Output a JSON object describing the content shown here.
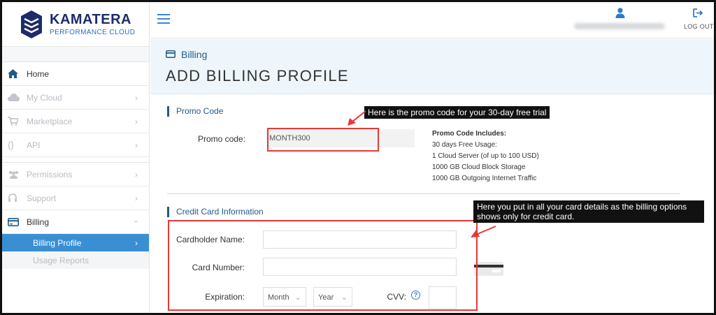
{
  "brand": {
    "name": "KAMATERA",
    "tagline": "PERFORMANCE CLOUD",
    "colors": {
      "navy": "#1d2b6a",
      "blue": "#2e6bbf",
      "accent": "#3a8fd2",
      "annotation_red": "#e53935"
    }
  },
  "sidebar": {
    "items": [
      {
        "label": "Home",
        "icon": "home-icon"
      },
      {
        "label": "My Cloud",
        "icon": "cloud-icon"
      },
      {
        "label": "Marketplace",
        "icon": "cart-icon"
      },
      {
        "label": "API",
        "icon": "code-braces-icon"
      },
      {
        "label": "Permissions",
        "icon": "users-icon"
      },
      {
        "label": "Support",
        "icon": "headset-icon"
      },
      {
        "label": "Billing",
        "icon": "card-icon"
      }
    ],
    "billing_sub": [
      {
        "label": "Billing Profile"
      },
      {
        "label": "Usage Reports"
      }
    ]
  },
  "topbar": {
    "menu_icon": "hamburger-icon",
    "user_icon": "user-icon",
    "logout_icon": "logout-icon",
    "logout_label": "LOG OUT"
  },
  "header": {
    "breadcrumb": "Billing",
    "title": "ADD BILLING PROFILE"
  },
  "promo": {
    "section_title": "Promo Code",
    "label": "Promo code:",
    "value": "MONTH300",
    "includes_title": "Promo Code Includes:",
    "includes": [
      "30 days Free Usage:",
      "1 Cloud Server (of up to 100 USD)",
      "1000 GB Cloud Block Storage",
      "1000 GB Outgoing Internet Traffic"
    ]
  },
  "credit_card": {
    "section_title": "Credit Card Information",
    "cardholder_label": "Cardholder Name:",
    "card_number_label": "Card Number:",
    "expiration_label": "Expiration:",
    "month_placeholder": "Month",
    "year_placeholder": "Year",
    "cvv_label": "CVV:",
    "help_glyph": "?"
  },
  "annotations": {
    "promo_note": "Here is the promo code for your 30-day free trial",
    "card_note_line1": "Here you put in all your card details as the billing options",
    "card_note_line2": "shows only for credit card."
  }
}
